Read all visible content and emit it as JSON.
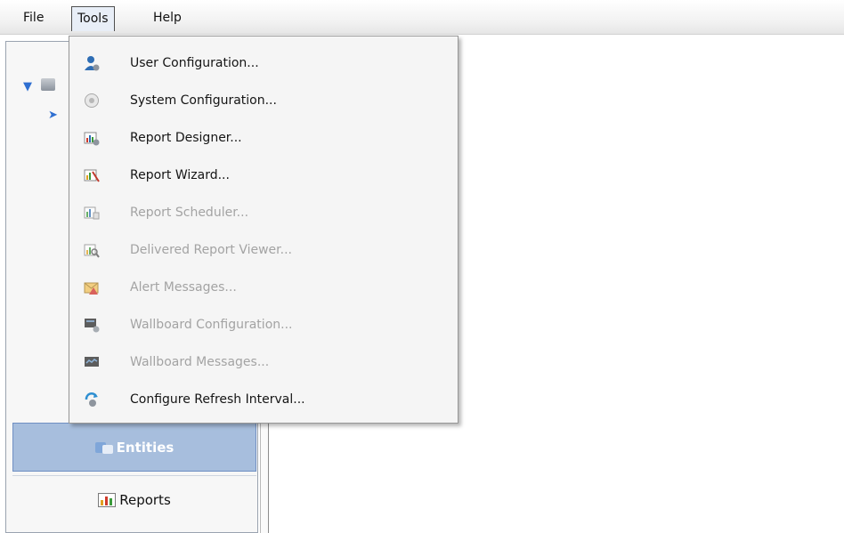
{
  "menubar": {
    "file": "File",
    "tools": "Tools",
    "help": "Help"
  },
  "tools_menu": {
    "items": [
      {
        "label": "User Configuration...",
        "icon": "user-config-icon",
        "enabled": true
      },
      {
        "label": "System Configuration...",
        "icon": "system-config-icon",
        "enabled": true
      },
      {
        "label": "Report Designer...",
        "icon": "report-designer-icon",
        "enabled": true
      },
      {
        "label": "Report Wizard...",
        "icon": "report-wizard-icon",
        "enabled": true
      },
      {
        "label": "Report Scheduler...",
        "icon": "report-scheduler-icon",
        "enabled": false
      },
      {
        "label": "Delivered Report Viewer...",
        "icon": "delivered-report-viewer-icon",
        "enabled": false
      },
      {
        "label": "Alert Messages...",
        "icon": "alert-messages-icon",
        "enabled": false
      },
      {
        "label": "Wallboard Configuration...",
        "icon": "wallboard-config-icon",
        "enabled": false
      },
      {
        "label": "Wallboard Messages...",
        "icon": "wallboard-messages-icon",
        "enabled": false
      },
      {
        "label": "Configure Refresh Interval...",
        "icon": "refresh-interval-icon",
        "enabled": true
      }
    ]
  },
  "navigation": {
    "entities": "Entities",
    "reports": "Reports"
  },
  "colors": {
    "nav_selected": "#a7bedd",
    "disabled_text": "#a3a3a3"
  }
}
